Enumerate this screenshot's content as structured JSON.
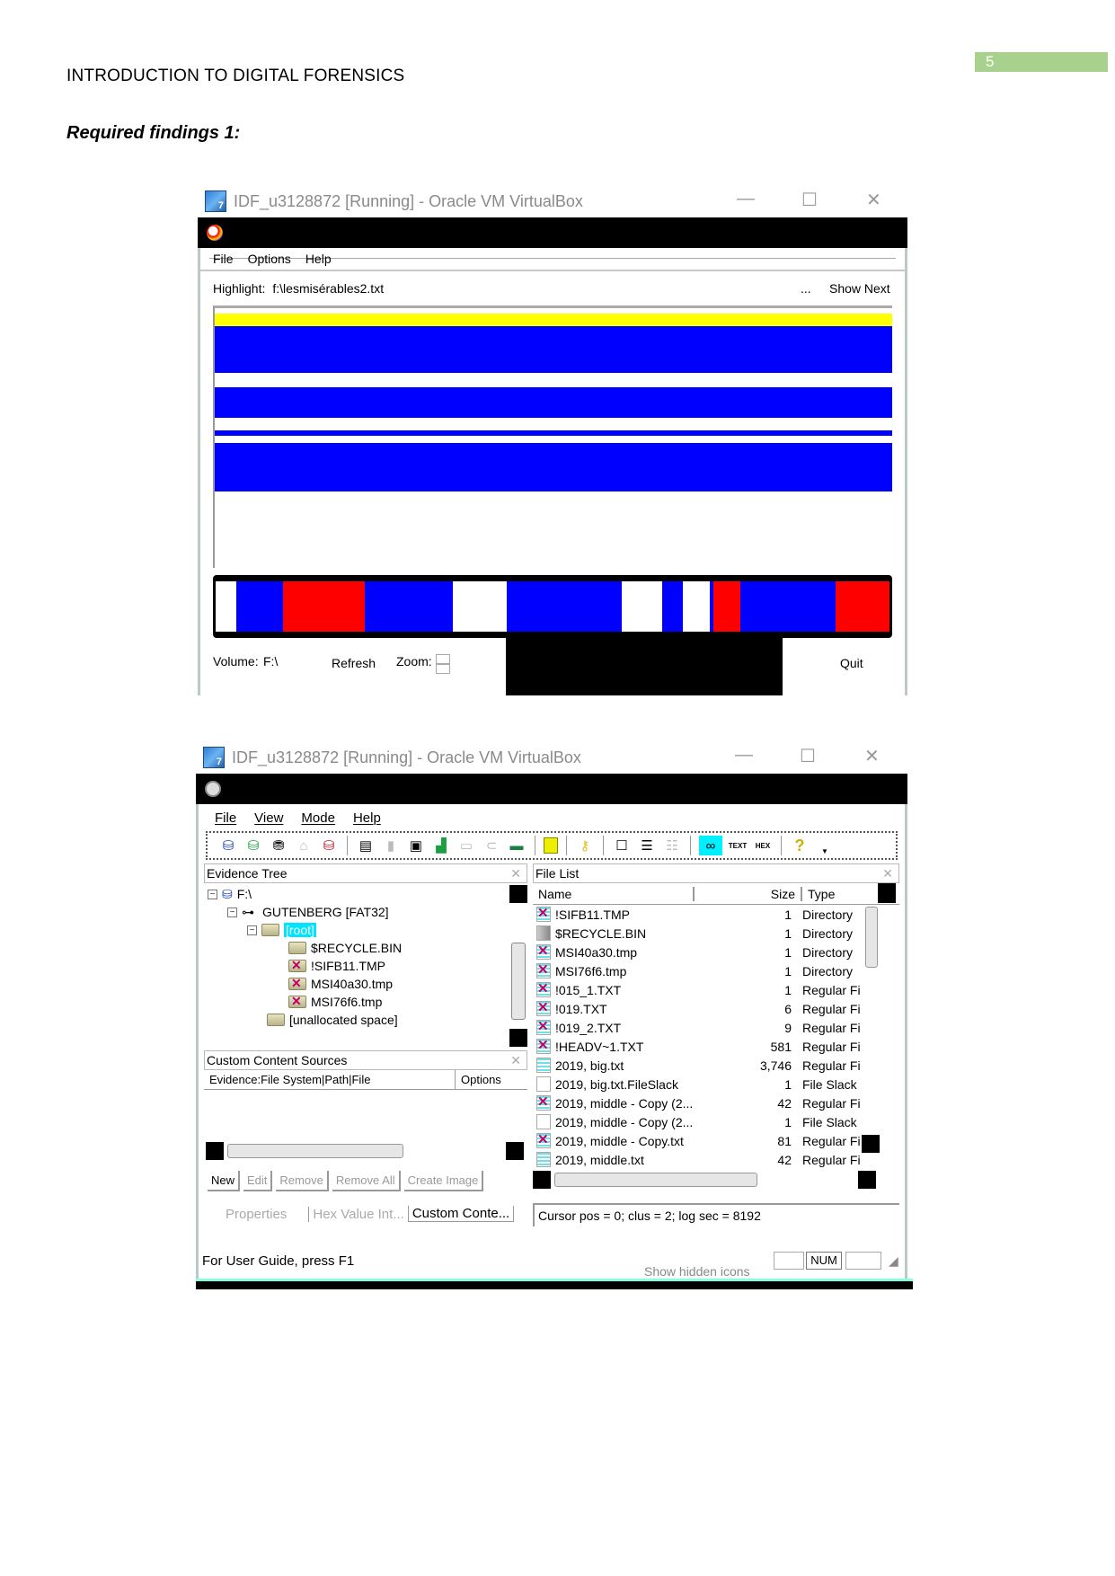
{
  "document": {
    "page_number": "5",
    "header": "INTRODUCTION TO DIGITAL FORENSICS",
    "section_title": "Required findings 1:"
  },
  "window1": {
    "title": "IDF_u3128872 [Running] - Oracle VM VirtualBox",
    "controls": {
      "minimize": "—",
      "maximize": "☐",
      "close": "✕"
    },
    "menu": [
      "File",
      "Options",
      "Help"
    ],
    "highlight_label": "Highlight:",
    "highlight_value": "f:\\lesmisérables2.txt",
    "ellipsis": "...",
    "show_next": "Show Next",
    "map_colors": {
      "highlight": "#ffff00",
      "allocated": "#0000ff",
      "free": "#ffffff",
      "deleted": "#ff0000"
    },
    "cluster_strip": [
      {
        "color": "#ffffff",
        "share": 3
      },
      {
        "color": "#0000ff",
        "share": 7
      },
      {
        "color": "#ff0000",
        "share": 12
      },
      {
        "color": "#0000ff",
        "share": 13
      },
      {
        "color": "#ffffff",
        "share": 8
      },
      {
        "color": "#0000ff",
        "share": 17
      },
      {
        "color": "#ffffff",
        "share": 6
      },
      {
        "color": "#0000ff",
        "share": 3
      },
      {
        "color": "#ffffff",
        "share": 4
      },
      {
        "color": "#0000ff",
        "share": 0.6
      },
      {
        "color": "#ff0000",
        "share": 4
      },
      {
        "color": "#0000ff",
        "share": 14
      },
      {
        "color": "#ff0000",
        "share": 8
      }
    ],
    "volume_label": "Volume:",
    "volume_value": "F:\\",
    "refresh": "Refresh",
    "zoom_label": "Zoom:",
    "quit": "Quit"
  },
  "window2": {
    "title": "IDF_u3128872 [Running] - Oracle VM VirtualBox",
    "controls": {
      "minimize": "—",
      "maximize": "☐",
      "close": "✕"
    },
    "menu": [
      "File",
      "View",
      "Mode",
      "Help"
    ],
    "toolbar_icons": [
      "add-evidence-icon",
      "add-all-evidence-icon",
      "image-database-icon",
      "remove-evidence-icon",
      "remove-all-evidence-icon",
      "create-disk-image-icon",
      "export-icon",
      "save-icon",
      "capture-memory-icon",
      "obtain-protected-files-icon",
      "detect-encrypted-icon",
      "memory-icon",
      "vault-icon",
      "key-icon",
      "new-document-icon",
      "text-document-icon",
      "report-icon",
      "view-glasses-icon",
      "text-view-icon",
      "hex-view-icon",
      "help-icon"
    ],
    "toolbar_text": {
      "text": "TEXT",
      "hex": "HEX",
      "help": "?"
    },
    "evidence_tree": {
      "title": "Evidence Tree",
      "close": "✕",
      "items": [
        {
          "label": "F:\\",
          "level": 0,
          "type": "drive"
        },
        {
          "label": "GUTENBERG [FAT32]",
          "level": 1,
          "type": "partition"
        },
        {
          "label": "[root]",
          "level": 2,
          "type": "folder",
          "selected": true
        },
        {
          "label": "$RECYCLE.BIN",
          "level": 3,
          "type": "folder"
        },
        {
          "label": "!SIFB11.TMP",
          "level": 3,
          "type": "deleted"
        },
        {
          "label": "MSI40a30.tmp",
          "level": 3,
          "type": "deleted"
        },
        {
          "label": "MSI76f6.tmp",
          "level": 3,
          "type": "deleted"
        },
        {
          "label": "[unallocated space]",
          "level": 2,
          "type": "folder"
        }
      ]
    },
    "custom_content": {
      "title": "Custom Content Sources",
      "close": "✕",
      "columns": [
        "Evidence:File System|Path|File",
        "Options"
      ],
      "buttons": [
        {
          "label": "New",
          "enabled": true
        },
        {
          "label": "Edit",
          "enabled": false
        },
        {
          "label": "Remove",
          "enabled": false
        },
        {
          "label": "Remove All",
          "enabled": false
        },
        {
          "label": "Create Image",
          "enabled": false
        }
      ]
    },
    "bottom_tabs": [
      "Properties",
      "Hex Value Int...",
      "Custom Conte..."
    ],
    "file_list": {
      "title": "File List",
      "close": "✕",
      "columns": [
        "Name",
        "Size",
        "Type"
      ],
      "rows": [
        {
          "name": "!SIFB11.TMP",
          "size": "1",
          "type": "Directory",
          "icon": "deleted"
        },
        {
          "name": "$RECYCLE.BIN",
          "size": "1",
          "type": "Directory",
          "icon": "dir"
        },
        {
          "name": "MSI40a30.tmp",
          "size": "1",
          "type": "Directory",
          "icon": "deleted"
        },
        {
          "name": "MSI76f6.tmp",
          "size": "1",
          "type": "Directory",
          "icon": "deleted"
        },
        {
          "name": "!015_1.TXT",
          "size": "1",
          "type": "Regular Fi",
          "icon": "deleted"
        },
        {
          "name": "!019.TXT",
          "size": "6",
          "type": "Regular Fi",
          "icon": "deleted"
        },
        {
          "name": "!019_2.TXT",
          "size": "9",
          "type": "Regular Fi",
          "icon": "deleted"
        },
        {
          "name": "!HEADV~1.TXT",
          "size": "581",
          "type": "Regular Fi",
          "icon": "deleted"
        },
        {
          "name": "2019, big.txt",
          "size": "3,746",
          "type": "Regular Fi",
          "icon": "txt"
        },
        {
          "name": "2019, big.txt.FileSlack",
          "size": "1",
          "type": "File Slack",
          "icon": "slack"
        },
        {
          "name": "2019, middle - Copy (2...",
          "size": "42",
          "type": "Regular Fi",
          "icon": "deleted"
        },
        {
          "name": "2019, middle - Copy (2...",
          "size": "1",
          "type": "File Slack",
          "icon": "slack"
        },
        {
          "name": "2019, middle - Copy.txt",
          "size": "81",
          "type": "Regular Fi",
          "icon": "deleted"
        },
        {
          "name": "2019, middle.txt",
          "size": "42",
          "type": "Regular Fi",
          "icon": "txt"
        }
      ]
    },
    "cursor_status": "Cursor pos = 0; clus = 2; log sec = 8192",
    "status_bar": "For User Guide, press F1",
    "num_indicator": "NUM",
    "taskbar_tooltip": "Show hidden icons"
  }
}
